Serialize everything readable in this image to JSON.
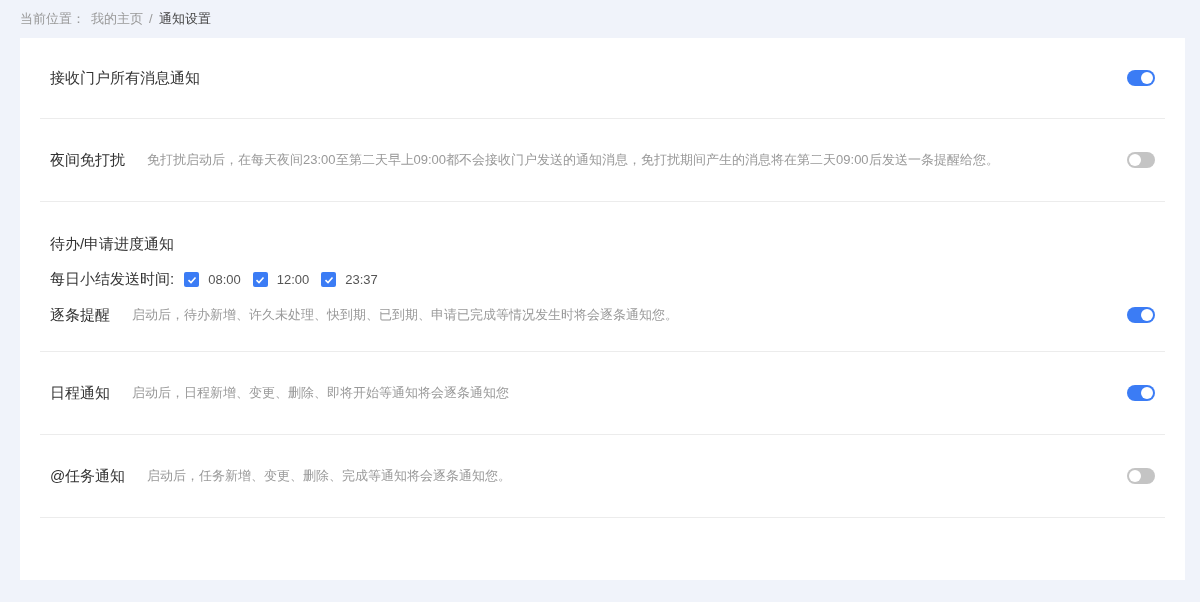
{
  "breadcrumb": {
    "prefix": "当前位置：",
    "items": [
      {
        "label": "我的主页",
        "current": false
      },
      {
        "label": "通知设置",
        "current": true
      }
    ],
    "separator": "/"
  },
  "settings": [
    {
      "kind": "toggle",
      "label": "接收门户所有消息通知",
      "on": true
    },
    {
      "kind": "toggle",
      "label": "夜间免打扰",
      "description": "免打扰启动后，在每天夜间23:00至第二天早上09:00都不会接收门户发送的通知消息，免打扰期间产生的消息将在第二天09:00后发送一条提醒给您。",
      "on": false
    },
    {
      "kind": "group",
      "title": "待办/申请进度通知",
      "summary_label": "每日小结发送时间:",
      "times": [
        {
          "label": "08:00",
          "checked": true
        },
        {
          "label": "12:00",
          "checked": true
        },
        {
          "label": "23:37",
          "checked": true
        }
      ],
      "label": "逐条提醒",
      "description": "启动后，待办新增、许久未处理、快到期、已到期、申请已完成等情况发生时将会逐条通知您。",
      "on": true
    },
    {
      "kind": "toggle",
      "label": "日程通知",
      "description": "启动后，日程新增、变更、删除、即将开始等通知将会逐条通知您",
      "on": true
    },
    {
      "kind": "toggle",
      "label": "@任务通知",
      "description": "启动后，任务新增、变更、删除、完成等通知将会逐条通知您。",
      "on": false
    }
  ]
}
